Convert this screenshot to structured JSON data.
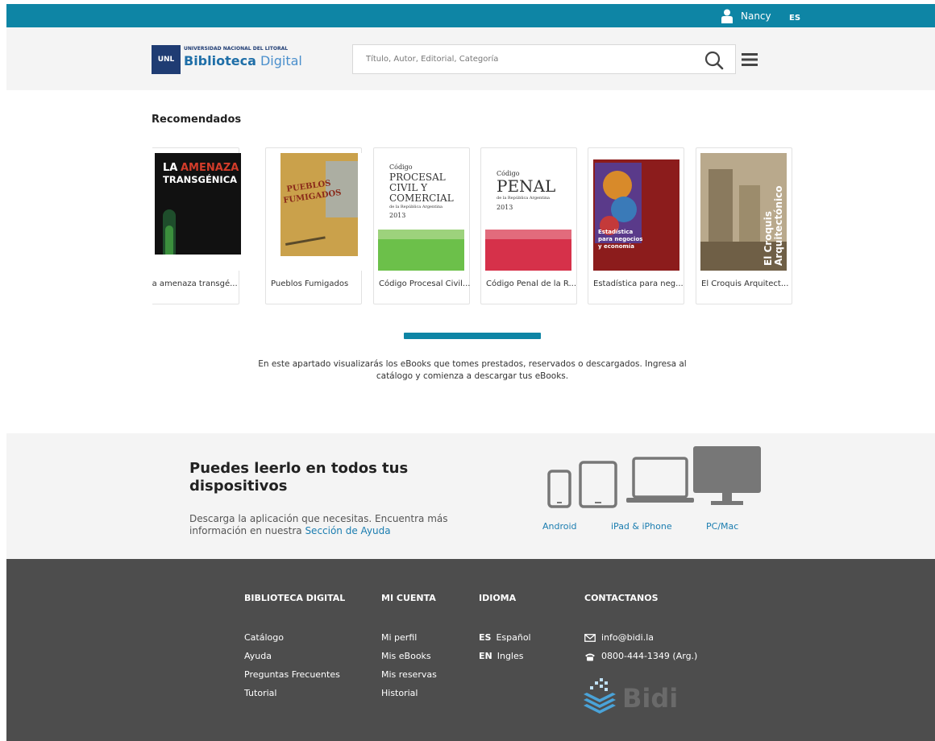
{
  "topbar": {
    "user_name": "Nancy",
    "language": "ES"
  },
  "header": {
    "logo_square": "UNL",
    "logo_university": "UNIVERSIDAD NACIONAL DEL LITORAL",
    "logo_bold": "Biblioteca",
    "logo_light": "Digital",
    "search_placeholder": "Título, Autor, Editorial, Categoría"
  },
  "recommended": {
    "title": "Recomendados",
    "books": [
      {
        "title": "La amenaza transgé..."
      },
      {
        "title": "Pueblos Fumigados"
      },
      {
        "title": "Código Procesal Civil..."
      },
      {
        "title": "Código Penal de la R..."
      },
      {
        "title": "Estadística para neg..."
      },
      {
        "title": "El Croquis Arquitect..."
      }
    ],
    "info_text": "En este apartado visualizarás los eBooks que tomes prestados, reservados o descargados. Ingresa al catálogo y comienza a descargar tus eBooks."
  },
  "devices": {
    "title": "Puedes leerlo en todos tus dispositivos",
    "text": "Descarga la aplicación que necesitas. Encuentra más información en nuestra",
    "help_link": "Sección de Ayuda",
    "links": [
      "Android",
      "iPad & iPhone",
      "PC/Mac"
    ]
  },
  "footer": {
    "columns": [
      {
        "heading": "BIBLIOTECA DIGITAL",
        "items": [
          "Catálogo",
          "Ayuda",
          "Preguntas Frecuentes",
          "Tutorial"
        ]
      },
      {
        "heading": "MI CUENTA",
        "items": [
          "Mi perfil",
          "Mis eBooks",
          "Mis reservas",
          "Historial"
        ]
      },
      {
        "heading": "IDIOMA",
        "items": [
          {
            "code": "ES",
            "label": "Español"
          },
          {
            "code": "EN",
            "label": "Ingles"
          }
        ]
      },
      {
        "heading": "CONTACTANOS",
        "items": [
          {
            "icon": "envelope-icon",
            "label": "info@bidi.la"
          },
          {
            "icon": "phone-icon",
            "label": "0800-444-1349 (Arg.)"
          }
        ]
      }
    ],
    "brand": "Bidi"
  },
  "colors": {
    "accent": "#0e85a5",
    "footer_bg": "#4d4d4d",
    "link": "#1b7db0"
  }
}
